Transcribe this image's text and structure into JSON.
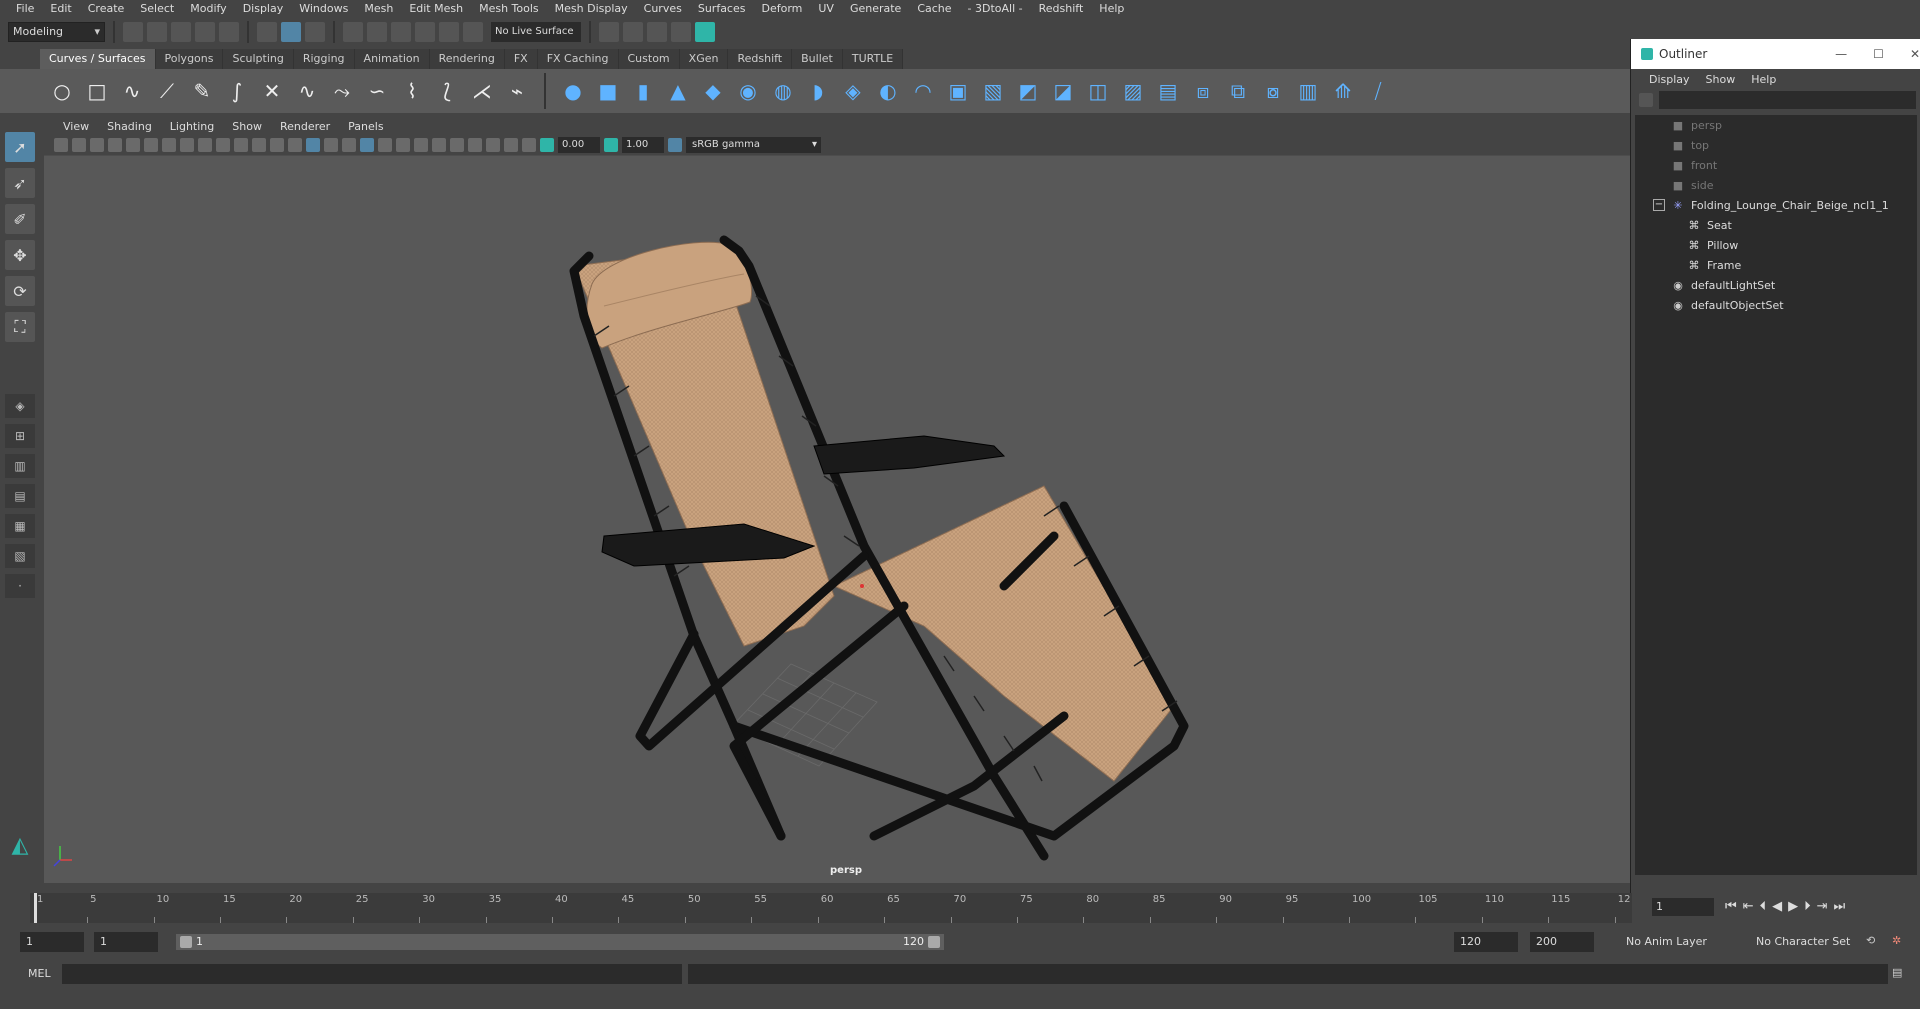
{
  "menubar": {
    "items": [
      "File",
      "Edit",
      "Create",
      "Select",
      "Modify",
      "Display",
      "Windows",
      "Mesh",
      "Edit Mesh",
      "Mesh Tools",
      "Mesh Display",
      "Curves",
      "Surfaces",
      "Deform",
      "UV",
      "Generate",
      "Cache",
      "- 3DtoAll -",
      "Redshift",
      "Help"
    ]
  },
  "statusline": {
    "mode": "Modeling",
    "live_surface": "No Live Surface"
  },
  "shelf": {
    "tabs": [
      "Curves / Surfaces",
      "Polygons",
      "Sculpting",
      "Rigging",
      "Animation",
      "Rendering",
      "FX",
      "FX Caching",
      "Custom",
      "XGen",
      "Redshift",
      "Bullet",
      "TURTLE"
    ],
    "active_tab": "Curves / Surfaces"
  },
  "panel": {
    "menus": [
      "View",
      "Shading",
      "Lighting",
      "Show",
      "Renderer",
      "Panels"
    ],
    "exposure": "0.00",
    "gamma": "1.00",
    "color_space": "sRGB gamma",
    "camera_label": "persp"
  },
  "outliner": {
    "title": "Outliner",
    "menus": [
      "Display",
      "Show",
      "Help"
    ],
    "items": [
      {
        "label": "persp",
        "icon": "camera-icon",
        "dim": true,
        "indent": 1
      },
      {
        "label": "top",
        "icon": "camera-icon",
        "dim": true,
        "indent": 1
      },
      {
        "label": "front",
        "icon": "camera-icon",
        "dim": true,
        "indent": 1
      },
      {
        "label": "side",
        "icon": "camera-icon",
        "dim": true,
        "indent": 1
      },
      {
        "label": "Folding_Lounge_Chair_Beige_ncl1_1",
        "icon": "group-icon",
        "dim": false,
        "indent": 1,
        "expanded": true
      },
      {
        "label": "Seat",
        "icon": "mesh-icon",
        "dim": false,
        "indent": 2
      },
      {
        "label": "Pillow",
        "icon": "mesh-icon",
        "dim": false,
        "indent": 2
      },
      {
        "label": "Frame",
        "icon": "mesh-icon",
        "dim": false,
        "indent": 2
      },
      {
        "label": "defaultLightSet",
        "icon": "set-icon",
        "dim": false,
        "indent": 1
      },
      {
        "label": "defaultObjectSet",
        "icon": "set-icon",
        "dim": false,
        "indent": 1
      }
    ]
  },
  "timeline": {
    "tick_labels": [
      "1",
      "5",
      "10",
      "15",
      "20",
      "25",
      "30",
      "35",
      "40",
      "45",
      "50",
      "55",
      "60",
      "65",
      "70",
      "75",
      "80",
      "85",
      "90",
      "95",
      "100",
      "105",
      "110",
      "115",
      "12"
    ],
    "current_frame": "1"
  },
  "range": {
    "start": "1",
    "playback_start": "1",
    "slider_start": "1",
    "slider_end": "120",
    "playback_end": "120",
    "end": "200",
    "anim_layer": "No Anim Layer",
    "character_set": "No Character Set"
  },
  "cmdline": {
    "label": "MEL"
  },
  "colors": {
    "accent": "#5285a6",
    "chair_fabric": "#c9a27e",
    "frame": "#111111"
  }
}
